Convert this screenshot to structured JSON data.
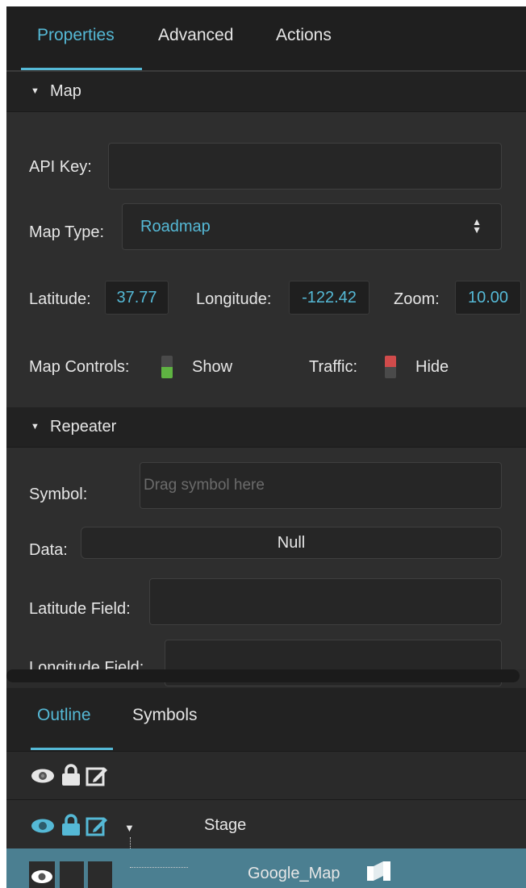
{
  "tabs": [
    {
      "label": "Properties",
      "active": true
    },
    {
      "label": "Advanced",
      "active": false
    },
    {
      "label": "Actions",
      "active": false
    }
  ],
  "map_section": {
    "title": "Map",
    "api_key": {
      "label": "API Key:",
      "value": ""
    },
    "map_type": {
      "label": "Map Type:",
      "value": "Roadmap"
    },
    "latitude": {
      "label": "Latitude:",
      "value": "37.77"
    },
    "longitude": {
      "label": "Longitude:",
      "value": "-122.42"
    },
    "zoom": {
      "label": "Zoom:",
      "value": "10.00"
    },
    "map_controls": {
      "label": "Map Controls:",
      "state": "Show",
      "color": "#5fb442"
    },
    "traffic": {
      "label": "Traffic:",
      "state": "Hide",
      "color": "#d04b4b"
    }
  },
  "repeater_section": {
    "title": "Repeater",
    "symbol": {
      "label": "Symbol:",
      "placeholder": "Drag symbol here"
    },
    "data": {
      "label": "Data:",
      "value": "Null"
    },
    "latitude_field": {
      "label": "Latitude Field:",
      "value": ""
    },
    "longitude_field": {
      "label": "Longitude Field:",
      "value": ""
    }
  },
  "bottom_tabs": [
    {
      "label": "Outline",
      "active": true
    },
    {
      "label": "Symbols",
      "active": false
    }
  ],
  "outline": {
    "header_icons": [
      "eye-icon",
      "lock-icon",
      "edit-icon"
    ],
    "rows": [
      {
        "label": "Stage",
        "expanded": true
      },
      {
        "label": "Google_Map",
        "selected": true,
        "type_icon": "map-symbol-icon"
      }
    ]
  },
  "colors": {
    "accent": "#55b9d6",
    "selected_row": "#4b7f91",
    "panel_bg": "#2e2e2e",
    "header_bg": "#222222"
  }
}
